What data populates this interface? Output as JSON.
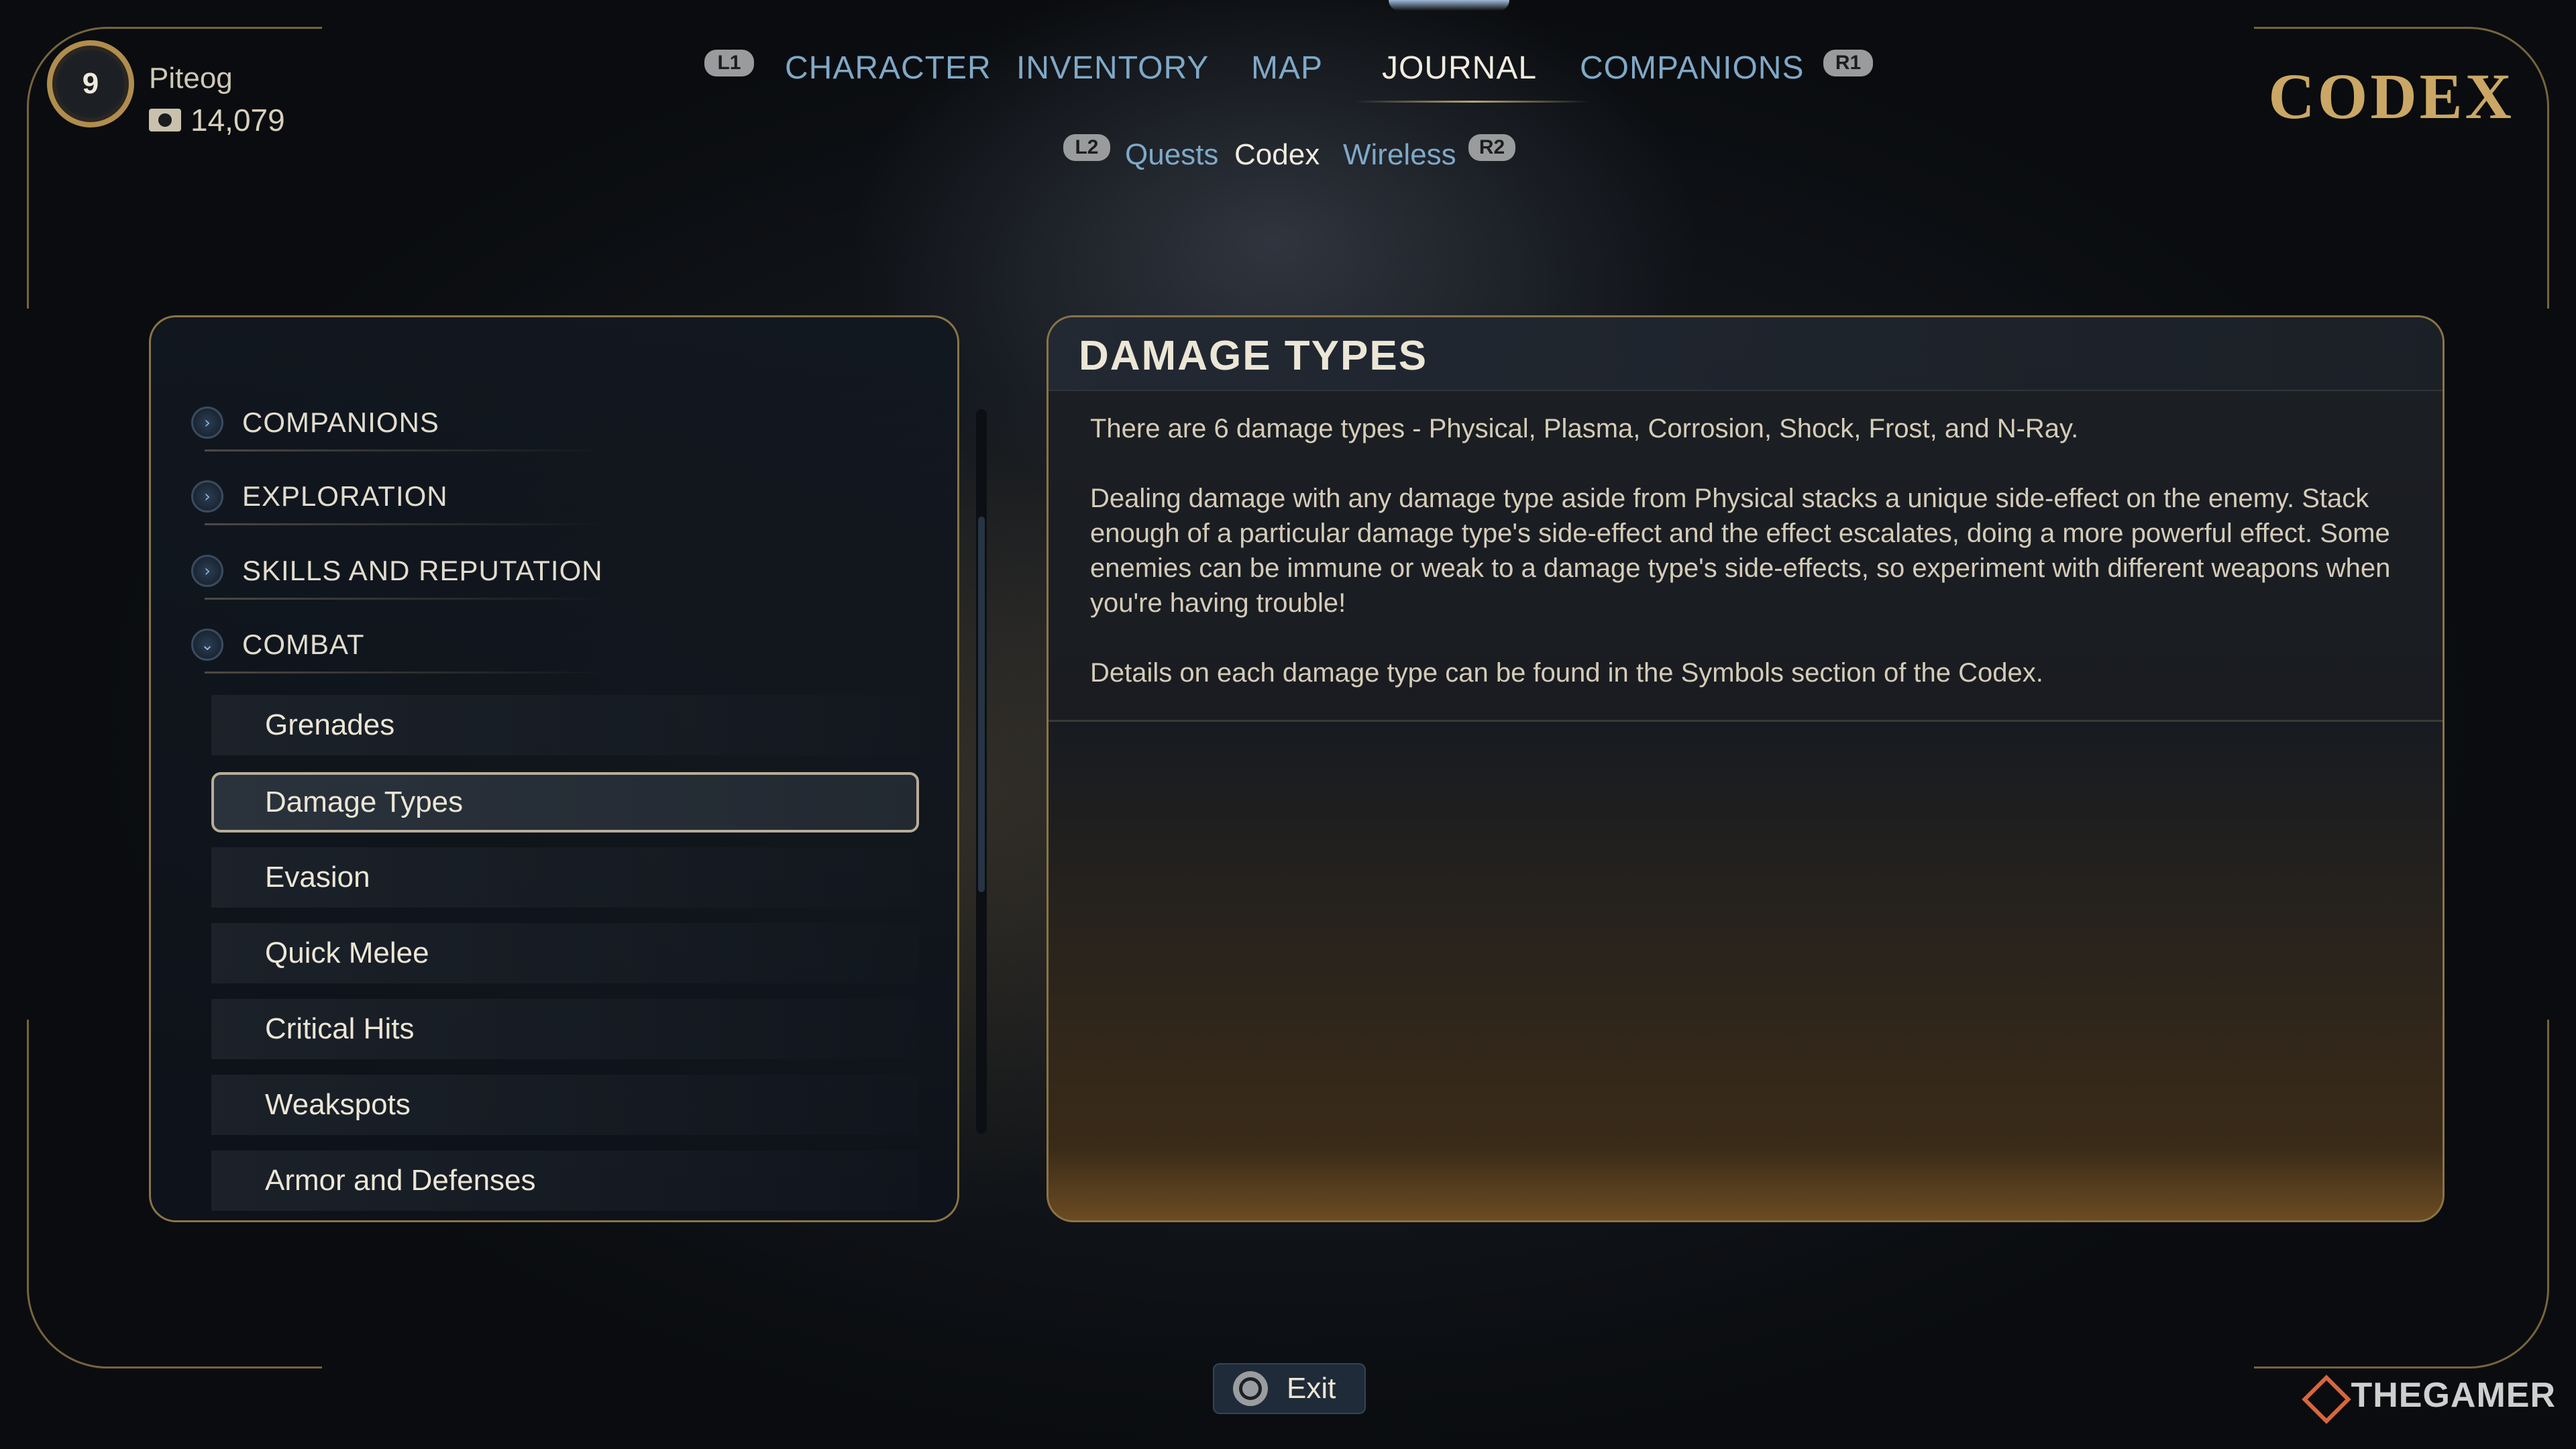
{
  "player": {
    "level": "9",
    "name": "Piteog",
    "money": "14,079"
  },
  "top_nav": {
    "left_hint": "L1",
    "right_hint": "R1",
    "tabs": [
      "CHARACTER",
      "INVENTORY",
      "MAP",
      "JOURNAL",
      "COMPANIONS"
    ],
    "active_tab": "JOURNAL"
  },
  "sub_nav": {
    "left_hint": "L2",
    "right_hint": "R2",
    "tabs": [
      "Quests",
      "Codex",
      "Wireless"
    ],
    "active_tab": "Codex"
  },
  "section_title": "CODEX",
  "sidebar": {
    "categories": [
      "COMPANIONS",
      "EXPLORATION",
      "SKILLS AND REPUTATION",
      "COMBAT"
    ],
    "category_icons": [
      "chevron-right-icon",
      "chevron-right-icon",
      "chevron-right-icon",
      "chevron-down-icon"
    ],
    "entries": [
      "Grenades",
      "Damage Types",
      "Evasion",
      "Quick Melee",
      "Critical Hits",
      "Weakspots",
      "Armor and Defenses"
    ],
    "selected_entry": "Damage Types"
  },
  "detail": {
    "title": "DAMAGE TYPES",
    "paragraphs": [
      "There are 6 damage types - Physical, Plasma, Corrosion, Shock, Frost, and N-Ray.",
      "Dealing damage with any damage type aside from Physical stacks a unique side-effect on the enemy. Stack enough of a particular damage type's side-effect and the effect escalates, doing a more powerful effect. Some enemies can be immune or weak to a damage type's side-effects, so experiment with different weapons when you're having trouble!",
      "Details on each damage type can be found in the Symbols section of the Codex."
    ]
  },
  "footer": {
    "exit_label": "Exit"
  },
  "watermark": "THEGAMER",
  "colors": {
    "accent_gold": "#caa765",
    "tab_blue": "#7fa9c7",
    "frame": "#8a7446"
  }
}
